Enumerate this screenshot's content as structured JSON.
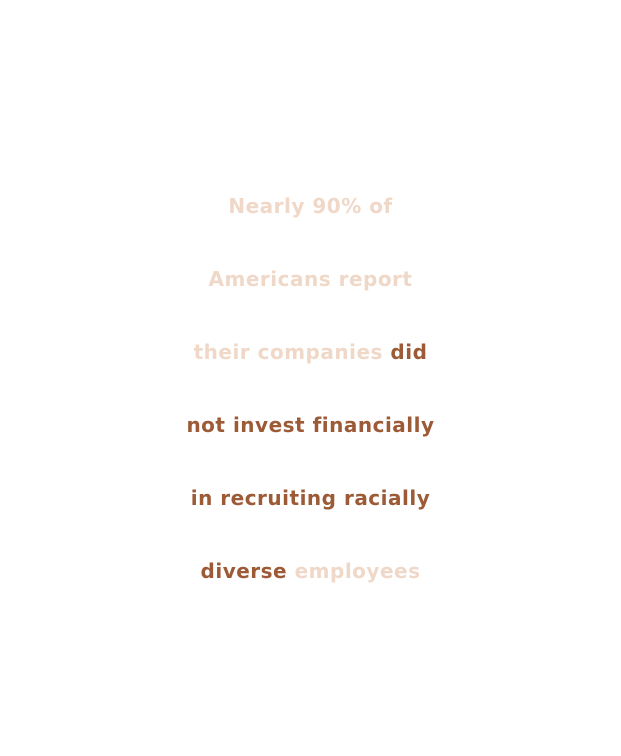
{
  "colors": {
    "background": "#ffffff",
    "muted_text": "#f0d8c8",
    "accent_text": "#9c5a36"
  },
  "statement": {
    "line1_muted": "Nearly 90% of",
    "line2_muted": "Americans report",
    "line3_muted": "their companies",
    "line3_accent": "did",
    "line4_accent": "not invest financially",
    "line5_accent": "in recruiting racially",
    "line6_accent": "diverse",
    "line6_muted": "employees"
  }
}
